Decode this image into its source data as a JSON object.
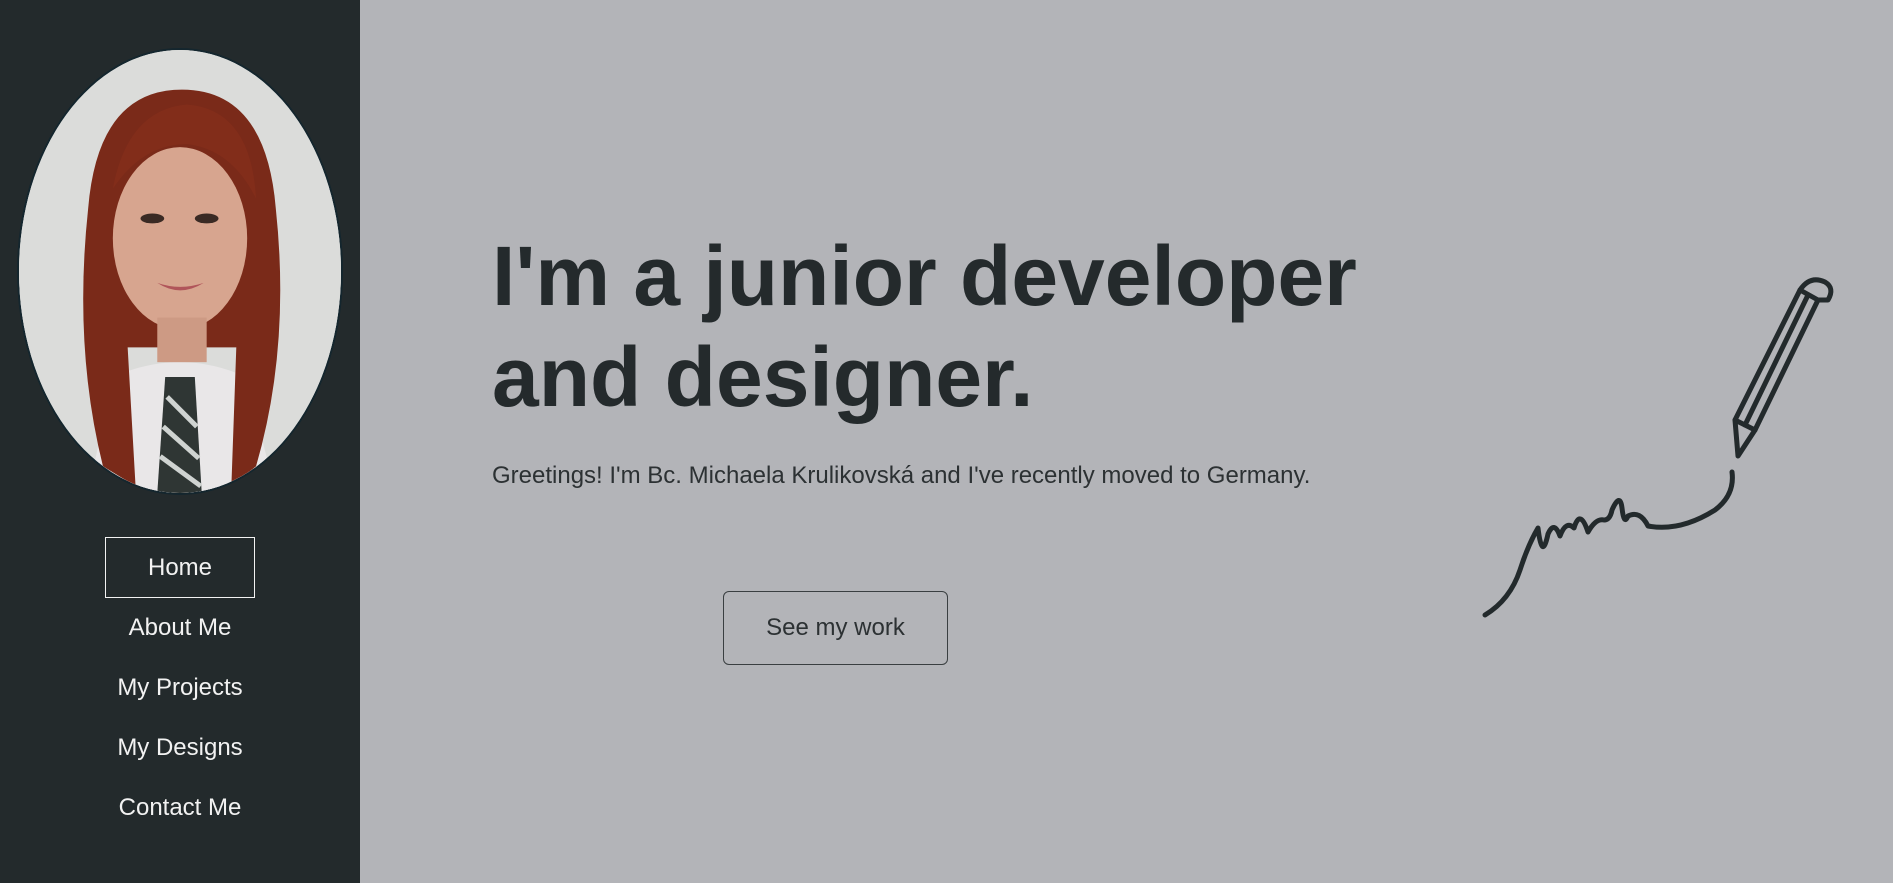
{
  "sidebar": {
    "nav": [
      {
        "label": "Home",
        "active": true
      },
      {
        "label": "About Me",
        "active": false
      },
      {
        "label": "My Projects",
        "active": false
      },
      {
        "label": "My Designs",
        "active": false
      },
      {
        "label": "Contact Me",
        "active": false
      }
    ]
  },
  "hero": {
    "headline_line1": "I'm a junior developer",
    "headline_line2": "and designer.",
    "intro": "Greetings! I'm Bc. Michaela Krulikovská and I've recently moved to Germany.",
    "cta_label": "See my work"
  },
  "icons": {
    "signature": "pencil-signature-icon"
  },
  "colors": {
    "sidebar_bg": "#232a2c",
    "page_bg": "#b3b4b8",
    "text_dark": "#242a2c",
    "nav_text": "#f2f2f2"
  }
}
